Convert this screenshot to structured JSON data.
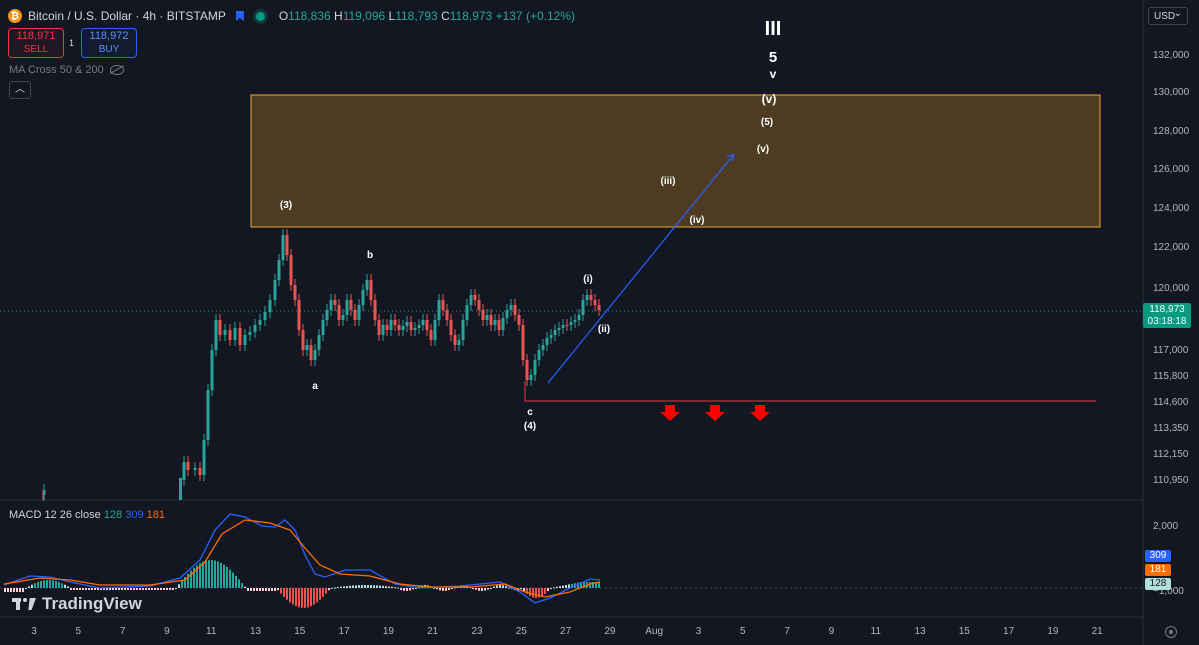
{
  "header": {
    "symbol": "Bitcoin / U.S. Dollar · 4h · BITSTAMP",
    "ohlc": {
      "o_label": "O",
      "o": "118,836",
      "h_label": "H",
      "h": "119,096",
      "l_label": "L",
      "l": "118,793",
      "c_label": "C",
      "c": "118,973",
      "change": "+137 (+0.12%)"
    }
  },
  "trade": {
    "sell_price": "118,971",
    "sell_label": "SELL",
    "spread": "1",
    "buy_price": "118,972",
    "buy_label": "BUY"
  },
  "indicator": {
    "ma_label": "MA Cross 50 & 200"
  },
  "currency": "USD",
  "price_axis": {
    "labels": [
      "132,000",
      "130,000",
      "128,000",
      "126,000",
      "124,000",
      "122,000",
      "120,000",
      "117,000",
      "115,800",
      "114,600",
      "113,350",
      "112,150",
      "110,950"
    ],
    "current_price": "118,973",
    "countdown": "03:18:18"
  },
  "macd": {
    "title": "MACD 12 26 close",
    "hist": "128",
    "macd": "309",
    "signal": "181",
    "axis_labels": [
      "2,000",
      "0",
      "−1,000"
    ]
  },
  "time_axis": {
    "labels": [
      "3",
      "5",
      "7",
      "9",
      "11",
      "13",
      "15",
      "17",
      "19",
      "21",
      "23",
      "25",
      "27",
      "29",
      "Aug",
      "3",
      "5",
      "7",
      "9",
      "11",
      "13",
      "15",
      "17",
      "19",
      "21"
    ]
  },
  "annotations": {
    "wave_III": "III",
    "wave_5": "5",
    "wave_v_small": "v",
    "wave_v_paren_top": "(v)",
    "wave_5_paren": "(5)",
    "wave_v_paren": "(v)",
    "wave_iii": "(iii)",
    "wave_iv": "(iv)",
    "wave_3": "(3)",
    "wave_b": "b",
    "wave_a": "a",
    "wave_i": "(i)",
    "wave_ii": "(ii)",
    "wave_c": "c",
    "wave_4": "(4)"
  },
  "colors": {
    "bg": "#131722",
    "up": "#26a69a",
    "down": "#ef5350",
    "zone": "#f5a623",
    "line_blue": "#2962ff",
    "support": "#f23645"
  },
  "branding": {
    "logo_text": "TradingView"
  }
}
